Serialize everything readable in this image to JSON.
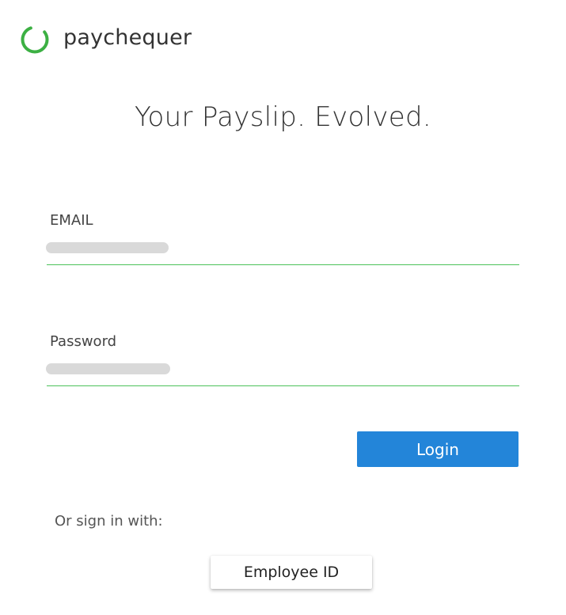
{
  "brand": {
    "name": "paychequer",
    "icon": "circle-arc-logo-icon",
    "accent_color": "#3cb043"
  },
  "hero": {
    "tagline": "Your Payslip. Evolved."
  },
  "form": {
    "email_label": "EMAIL",
    "password_label": "Password",
    "underline_color": "#4cc25a"
  },
  "actions": {
    "login_label": "Login",
    "login_color": "#2385d9",
    "alt_signin_label": "Or sign in with:",
    "employee_id_label": "Employee ID"
  }
}
